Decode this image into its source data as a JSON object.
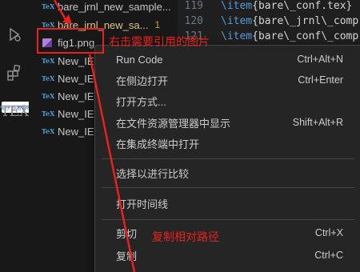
{
  "activity_bar": {
    "icons": [
      "debug-icon",
      "extensions-icon",
      "tex-icon"
    ],
    "tex_label": "TEX",
    "watermark_text": "知乎 作者署名"
  },
  "explorer": {
    "files": [
      {
        "name": "bare_jrnl_new_sample...",
        "icon": "tex-icon",
        "badge": ""
      },
      {
        "name": "bare_jrnl_new_sa...",
        "icon": "tex-icon",
        "badge": "1"
      },
      {
        "name": "fig1.png",
        "icon": "image-icon",
        "badge": ""
      },
      {
        "name": "New_IE",
        "icon": "tex-icon",
        "badge": ""
      },
      {
        "name": "New_IE",
        "icon": "tex-icon",
        "badge": ""
      },
      {
        "name": "New_IE",
        "icon": "tex-icon",
        "badge": ""
      },
      {
        "name": "New_IE",
        "icon": "tex-icon",
        "badge": ""
      },
      {
        "name": "New_IE",
        "icon": "tex-icon",
        "badge": ""
      }
    ]
  },
  "editor": {
    "lines": [
      {
        "num": "119",
        "cmd": "\\item",
        "rest": "{bare\\_conf.tex}"
      },
      {
        "num": "120",
        "cmd": "\\item",
        "rest": "{bare\\_jrnl\\_comp"
      },
      {
        "num": "121",
        "cmd": "\\item",
        "rest": "{bare\\_conf\\_comp"
      }
    ]
  },
  "context_menu": {
    "items": [
      {
        "label": "Run Code",
        "shortcut": "Ctrl+Alt+N"
      },
      {
        "label": "在侧边打开",
        "shortcut": "Ctrl+Enter"
      },
      {
        "label": "打开方式...",
        "shortcut": ""
      },
      {
        "label": "在文件资源管理器中显示",
        "shortcut": "Shift+Alt+R"
      },
      {
        "label": "在集成终端中打开",
        "shortcut": ""
      },
      {
        "label": "选择以进行比较",
        "shortcut": ""
      },
      {
        "label": "打开时间线",
        "shortcut": ""
      },
      {
        "label": "剪切",
        "shortcut": "Ctrl+X"
      },
      {
        "label": "复制",
        "shortcut": "Ctrl+C"
      }
    ]
  },
  "annotations": {
    "right_click_note": "右击需要引用的图片",
    "copy_path_note": "复制相对路径",
    "color": "#e8221b"
  },
  "colors": {
    "background": "#1e1e1e",
    "menu_background": "#252526",
    "tex_icon": "#4b9fd5",
    "image_icon": "#b180d7",
    "badge": "#cca700"
  }
}
